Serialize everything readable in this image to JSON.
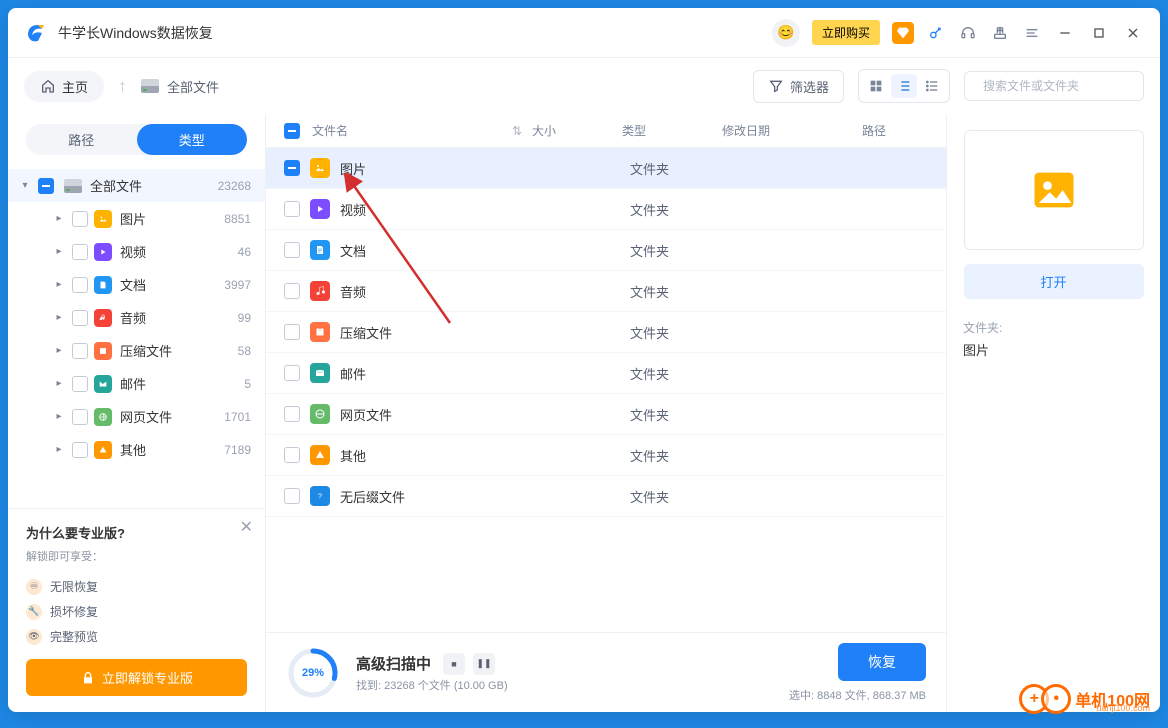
{
  "app": {
    "title": "牛学长Windows数据恢复"
  },
  "titlebar": {
    "buy_now": "立即购买"
  },
  "toolbar": {
    "home": "主页",
    "breadcrumb": "全部文件",
    "filter": "筛选器",
    "search_placeholder": "搜索文件或文件夹"
  },
  "sidebar": {
    "tabs": {
      "path": "路径",
      "type": "类型"
    },
    "root": {
      "label": "全部文件",
      "count": "23268"
    },
    "items": [
      {
        "label": "图片",
        "count": "8851"
      },
      {
        "label": "视频",
        "count": "46"
      },
      {
        "label": "文档",
        "count": "3997"
      },
      {
        "label": "音频",
        "count": "99"
      },
      {
        "label": "压缩文件",
        "count": "58"
      },
      {
        "label": "邮件",
        "count": "5"
      },
      {
        "label": "网页文件",
        "count": "1701"
      },
      {
        "label": "其他",
        "count": "7189"
      }
    ],
    "promo": {
      "title": "为什么要专业版?",
      "subtitle": "解锁即可享受：",
      "feature1": "无限恢复",
      "feature2": "损坏修复",
      "feature3": "完整预览",
      "unlock": "立即解锁专业版"
    }
  },
  "columns": {
    "name": "文件名",
    "size": "大小",
    "type": "类型",
    "date": "修改日期",
    "path": "路径"
  },
  "rows": [
    {
      "name": "图片",
      "type": "文件夹"
    },
    {
      "name": "视频",
      "type": "文件夹"
    },
    {
      "name": "文档",
      "type": "文件夹"
    },
    {
      "name": "音频",
      "type": "文件夹"
    },
    {
      "name": "压缩文件",
      "type": "文件夹"
    },
    {
      "name": "邮件",
      "type": "文件夹"
    },
    {
      "name": "网页文件",
      "type": "文件夹"
    },
    {
      "name": "其他",
      "type": "文件夹"
    },
    {
      "name": "无后缀文件",
      "type": "文件夹"
    }
  ],
  "preview": {
    "open": "打开",
    "meta_label": "文件夹:",
    "meta_value": "图片"
  },
  "footer": {
    "progress_pct": "29%",
    "scan_title": "高级扫描中",
    "scan_sub": "找到: 23268 个文件 (10.00 GB)",
    "recover": "恢复",
    "selected": "选中: 8848 文件, 868.37 MB"
  },
  "watermark": {
    "brand": "单机100网",
    "url": "danji100.com"
  }
}
